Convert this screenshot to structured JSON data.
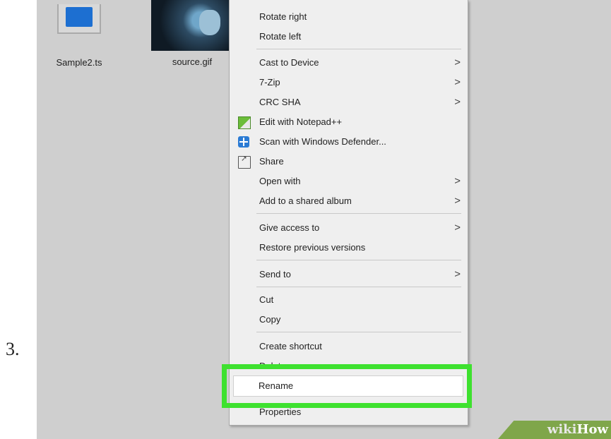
{
  "step": {
    "number": "3."
  },
  "desktop": {
    "files": [
      {
        "name": "Sample2.ts",
        "icon": "video-file-icon"
      },
      {
        "name": "source.gif",
        "icon": "image-thumbnail"
      }
    ]
  },
  "context_menu": {
    "items": [
      {
        "label": "Rotate right",
        "submenu": false
      },
      {
        "label": "Rotate left",
        "submenu": false
      },
      {
        "label": "Cast to Device",
        "submenu": true
      },
      {
        "label": "7-Zip",
        "submenu": true
      },
      {
        "label": "CRC SHA",
        "submenu": true
      },
      {
        "label": "Edit with Notepad++",
        "icon": "notepad-plus-plus-icon",
        "submenu": false
      },
      {
        "label": "Scan with Windows Defender...",
        "icon": "windows-defender-icon",
        "submenu": false
      },
      {
        "label": "Share",
        "icon": "share-icon",
        "submenu": false
      },
      {
        "label": "Open with",
        "submenu": true
      },
      {
        "label": "Add to a shared album",
        "submenu": true
      },
      {
        "label": "Give access to",
        "submenu": true
      },
      {
        "label": "Restore previous versions",
        "submenu": false
      },
      {
        "label": "Send to",
        "submenu": true
      },
      {
        "label": "Cut",
        "submenu": false
      },
      {
        "label": "Copy",
        "submenu": false
      },
      {
        "label": "Create shortcut",
        "submenu": false
      },
      {
        "label": "Delete",
        "submenu": false
      },
      {
        "label": "Rename",
        "submenu": false,
        "highlighted": true
      },
      {
        "label": "Properties",
        "submenu": false
      }
    ],
    "submenu_glyph": ">"
  },
  "highlight": {
    "color": "#3ee12f",
    "target": "Rename"
  },
  "watermark": {
    "part1": "wiki",
    "part2": "How"
  }
}
